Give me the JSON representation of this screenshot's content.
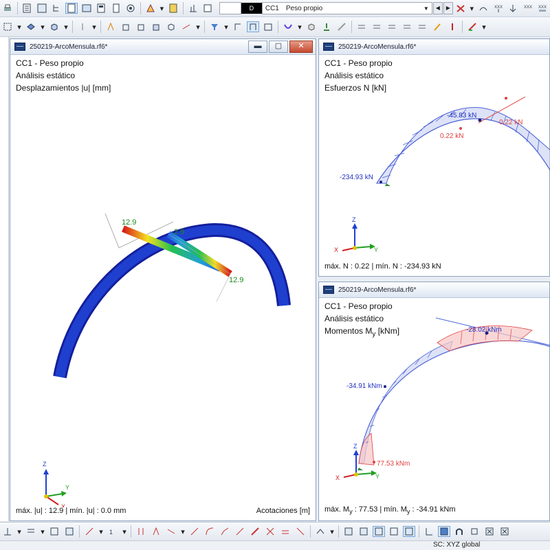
{
  "toolbar": {
    "load_case_code": "D",
    "load_case_id": "CC1",
    "load_case_name": "Peso propio"
  },
  "windows": {
    "displacements": {
      "title": "250219-ArcoMensula.rf6*",
      "line1": "CC1 - Peso propio",
      "line2": "Análisis estático",
      "line3": "Desplazamientos |u| [mm]",
      "label_top": "12.9",
      "label_mid": "2.9",
      "label_right": "12.9",
      "footer": "máx. |u| : 12.9 | mín. |u| : 0.0 mm",
      "footer_right": "Acotaciones [m]",
      "axis_z": "Z",
      "axis_x": "X",
      "axis_y": "Y"
    },
    "normal": {
      "title": "250219-ArcoMensula.rf6*",
      "line1": "CC1 - Peso propio",
      "line2": "Análisis estático",
      "line3": "Esfuerzos N [kN]",
      "label_top": "-45.83 kN",
      "label_right1": "0.22 kN",
      "label_right2": "0.22 kN",
      "label_left": "-234.93 kN",
      "footer": "máx. N : 0.22 | mín. N : -234.93 kN",
      "axis_z": "Z",
      "axis_x": "X",
      "axis_y": "Y"
    },
    "moments": {
      "title": "250219-ArcoMensula.rf6*",
      "line1": "CC1 - Peso propio",
      "line2": "Análisis estático",
      "line3_main": "Momentos M",
      "line3_sub": "y",
      "line3_unit": " [kNm]",
      "label_top": "-28.02 kNm",
      "label_left": "-34.91 kNm",
      "label_bottom": "77.53 kNm",
      "footer_a": "máx. M",
      "footer_sub1": "y",
      "footer_b": " : 77.53 | mín. M",
      "footer_sub2": "y",
      "footer_c": " : -34.91 kNm",
      "axis_z": "Z",
      "axis_x": "X",
      "axis_y": "Y"
    }
  },
  "status": {
    "coordinate_system": "SC: XYZ global"
  },
  "colors": {
    "beam_blue": "#1f3fcf",
    "positive_red": "#e04040",
    "negative_blue": "#4a62d8",
    "label_green": "#1a8a1a"
  }
}
